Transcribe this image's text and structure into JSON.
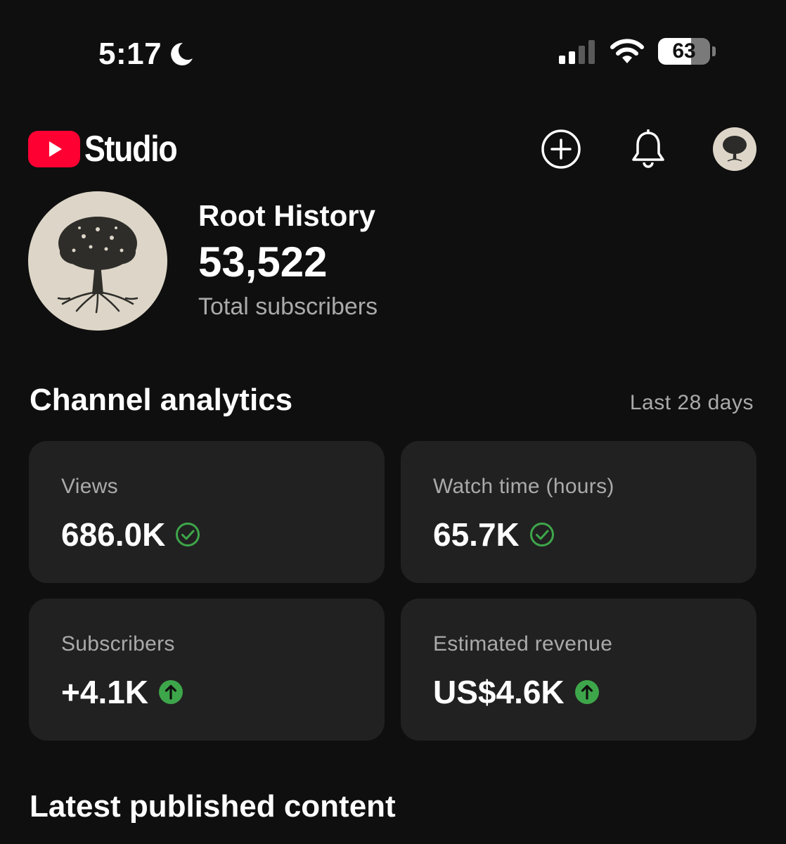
{
  "status_bar": {
    "time": "5:17",
    "focus_icon": "moon-icon",
    "battery": "63",
    "battery_level": 0.63
  },
  "header": {
    "logo_text": "Studio",
    "create_icon": "add-circle-icon",
    "notifications_icon": "bell-icon",
    "accent": "#ff0033"
  },
  "channel": {
    "name": "Root History",
    "subscribers": "53,522",
    "subscribers_label": "Total subscribers"
  },
  "analytics": {
    "title": "Channel analytics",
    "period": "Last 28 days",
    "cards": [
      {
        "label": "Views",
        "value": "686.0K",
        "icon": "check-circle-icon"
      },
      {
        "label": "Watch time (hours)",
        "value": "65.7K",
        "icon": "check-circle-icon"
      },
      {
        "label": "Subscribers",
        "value": "+4.1K",
        "icon": "arrow-up-circle-icon"
      },
      {
        "label": "Estimated revenue",
        "value": "US$4.6K",
        "icon": "arrow-up-circle-icon"
      }
    ],
    "positive_color": "#3ea64a"
  },
  "latest": {
    "title": "Latest published content"
  }
}
